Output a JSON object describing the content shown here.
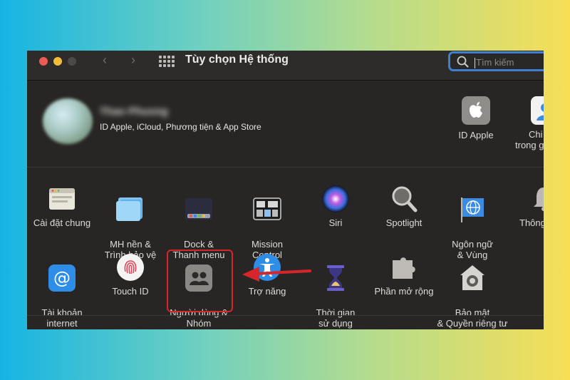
{
  "window": {
    "title": "Tùy chọn Hệ thống",
    "search_placeholder": "Tìm kiếm"
  },
  "account": {
    "name": "Thao Phuong",
    "subtitle": "ID Apple, iCloud, Phương tiện & App Store",
    "apple_id_label": "ID Apple",
    "family_label_line1": "Chi",
    "family_label_line2": "trong g"
  },
  "row1": [
    {
      "label": "Cài đặt chung",
      "icon": "general-icon"
    },
    {
      "label": "MH nền &\nTrình bảo vệ MH",
      "icon": "desktop-screensaver-icon"
    },
    {
      "label": "Dock &\nThanh menu",
      "icon": "dock-icon"
    },
    {
      "label": "Mission\nControl",
      "icon": "mission-control-icon"
    },
    {
      "label": "Siri",
      "icon": "siri-icon"
    },
    {
      "label": "Spotlight",
      "icon": "spotlight-icon"
    },
    {
      "label": "Ngôn ngữ\n& Vùng",
      "icon": "language-region-icon"
    },
    {
      "label": "Thông",
      "icon": "notifications-icon"
    }
  ],
  "row2": [
    {
      "label": "Tài khoản\ninternet",
      "icon": "internet-accounts-icon"
    },
    {
      "label": "Touch ID",
      "icon": "touch-id-icon"
    },
    {
      "label": "Người dùng &\nNhóm",
      "icon": "users-groups-icon"
    },
    {
      "label": "Trợ năng",
      "icon": "accessibility-icon"
    },
    {
      "label": "Thời gian\nsử dụng",
      "icon": "screen-time-icon"
    },
    {
      "label": "Phần mở rộng",
      "icon": "extensions-icon"
    },
    {
      "label": "Bảo mật\n& Quyền riêng tư",
      "icon": "security-privacy-icon"
    }
  ],
  "colors": {
    "highlight": "#d7262b",
    "window_bg": "#282624",
    "search_focus": "#3e7fd0"
  }
}
